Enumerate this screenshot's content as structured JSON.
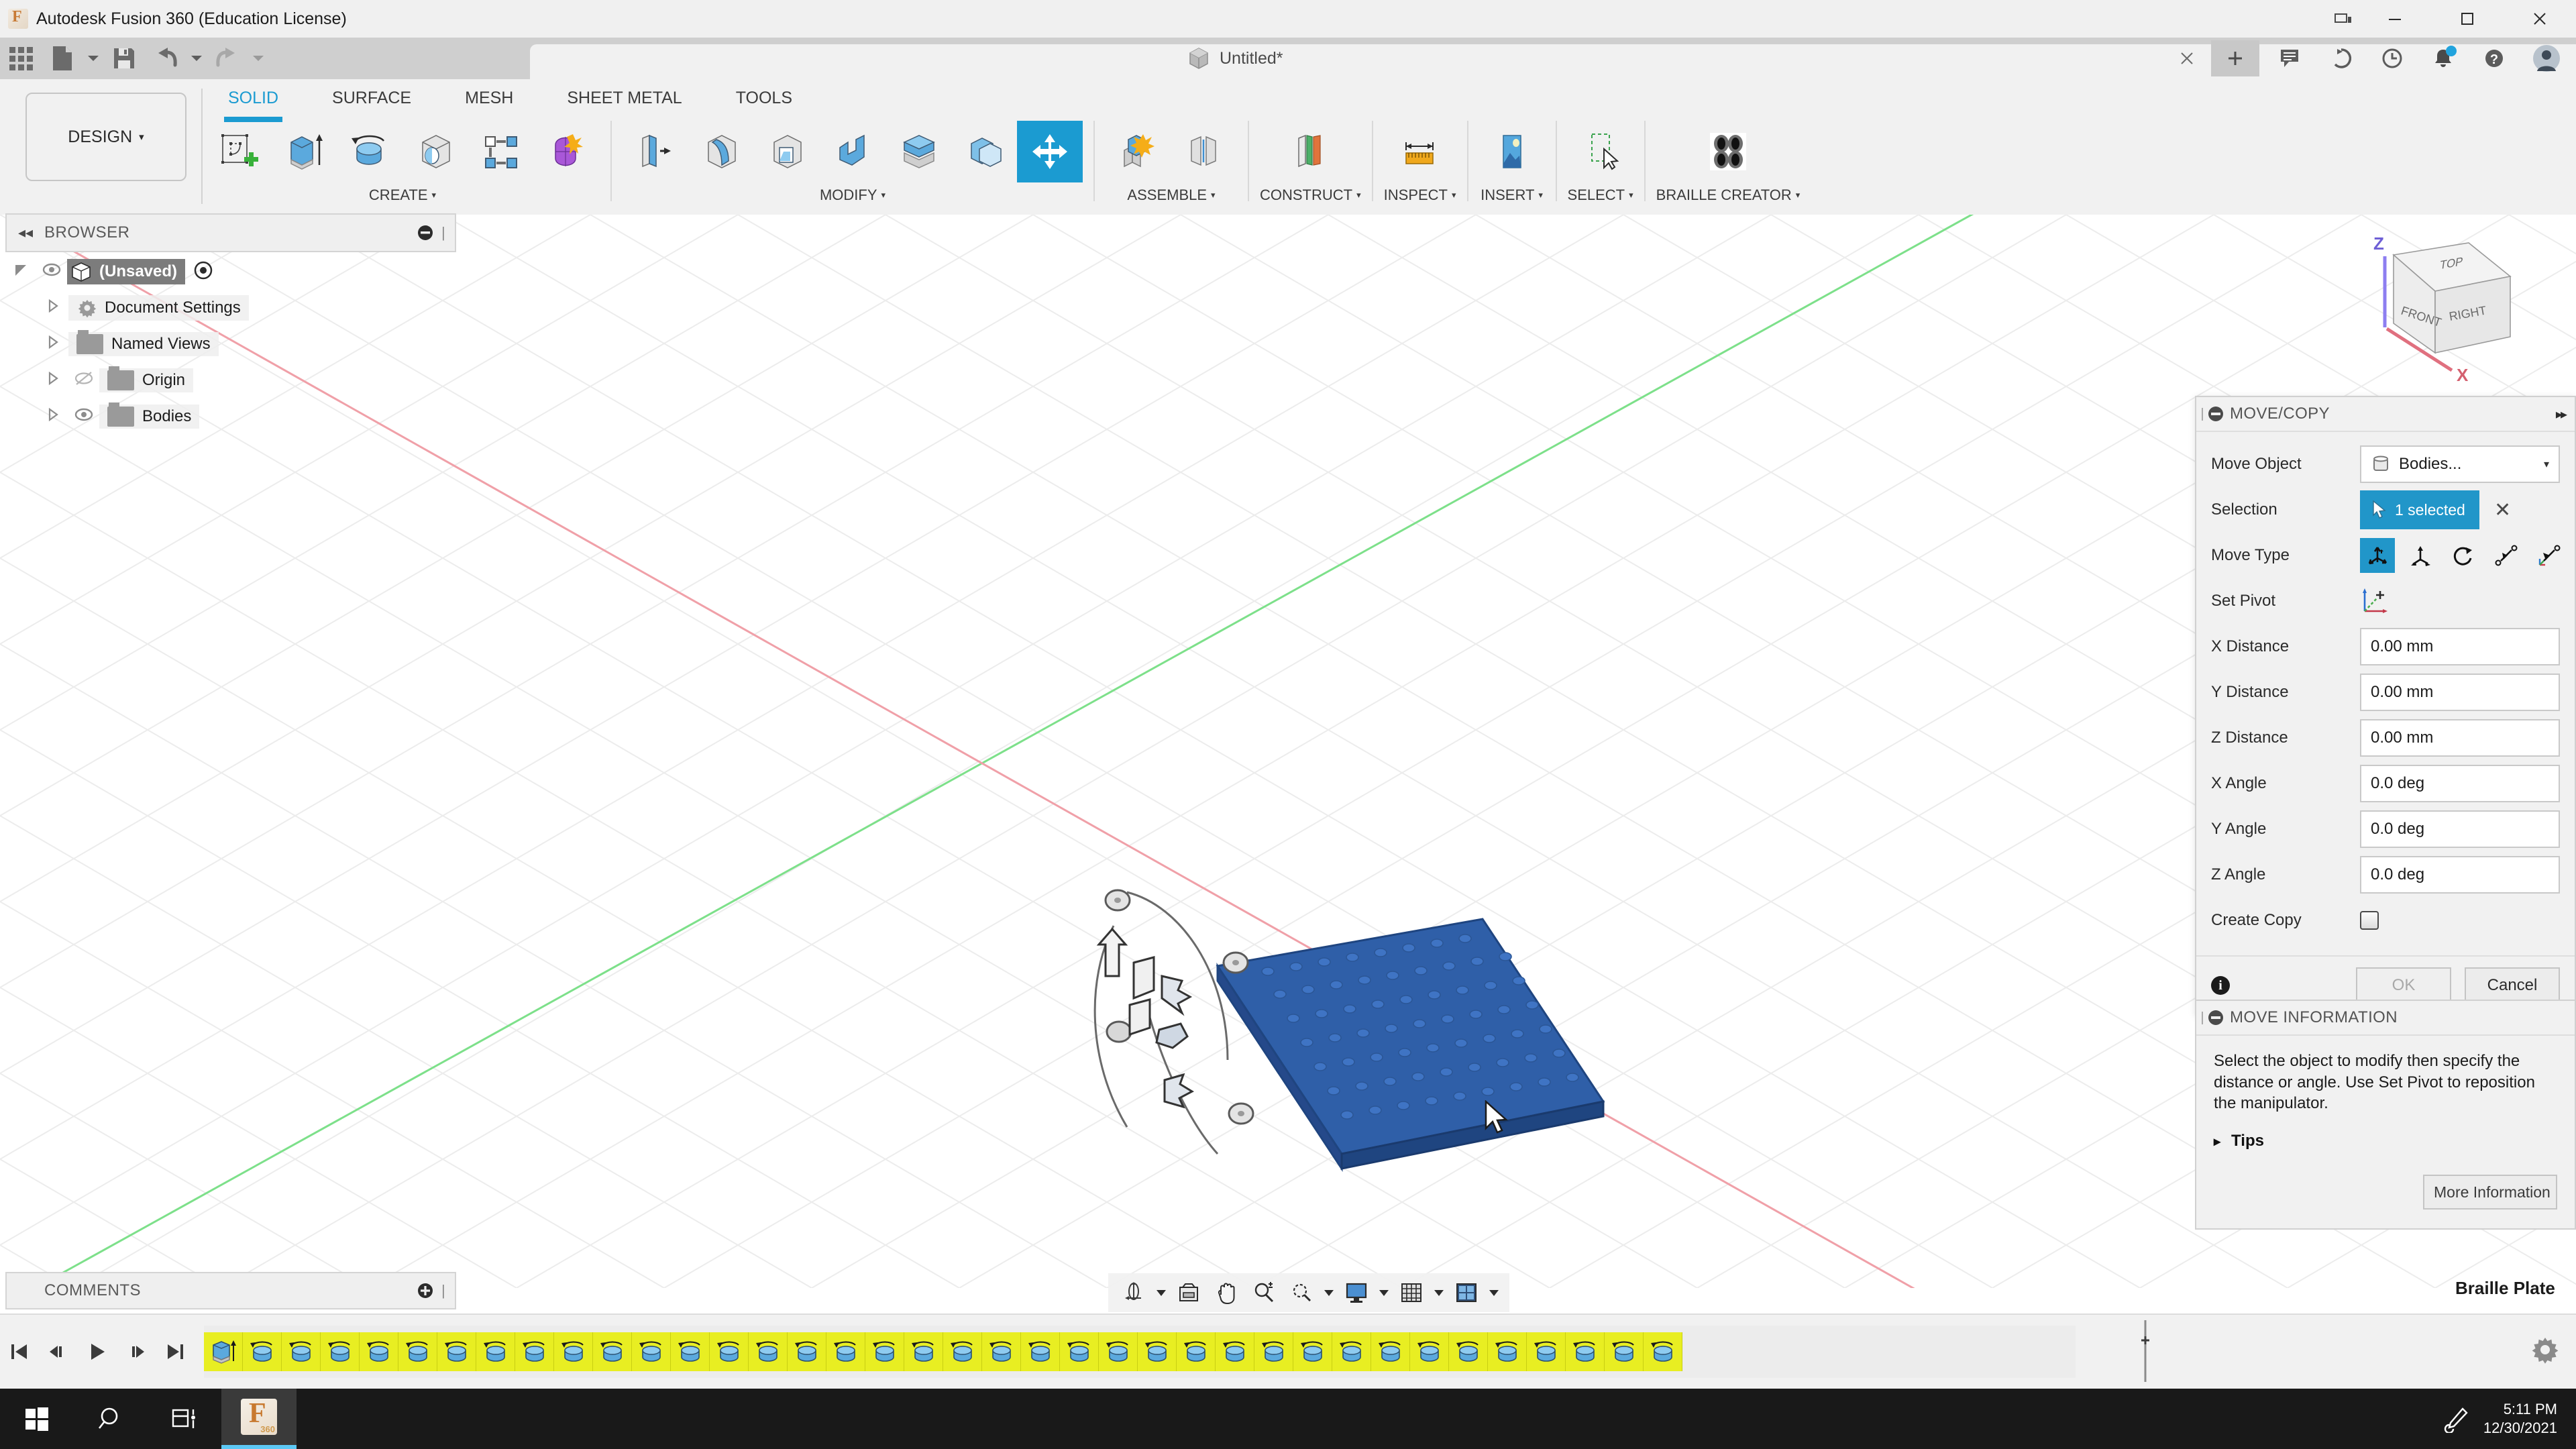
{
  "window": {
    "app_title": "Autodesk Fusion 360 (Education License)",
    "app_icon": "fusion-logo-icon",
    "minimize": "–",
    "maximize": "☐",
    "close": "✕"
  },
  "quick_access": {
    "items": [
      {
        "name": "app-grid-button",
        "icon": "grid-icon"
      },
      {
        "name": "new-file-button",
        "icon": "file-icon",
        "has_caret": true
      },
      {
        "name": "save-button",
        "icon": "save-icon"
      },
      {
        "name": "undo-button",
        "icon": "undo-icon",
        "has_caret": true
      },
      {
        "name": "redo-button",
        "icon": "redo-icon",
        "has_caret": true
      }
    ]
  },
  "document_tab": {
    "title": "Untitled*",
    "close_label": "✕",
    "add_label": "+"
  },
  "header_icons": [
    {
      "name": "comments-icon",
      "glyph": "💬"
    },
    {
      "name": "share-icon",
      "glyph": "⟳"
    },
    {
      "name": "history-icon",
      "glyph": "🕐"
    },
    {
      "name": "notifications-icon",
      "glyph": "🔔"
    },
    {
      "name": "help-icon",
      "glyph": "?"
    },
    {
      "name": "account-avatar",
      "glyph": "👤"
    }
  ],
  "workspace_button": {
    "label": "DESIGN",
    "caret": "▾"
  },
  "ribbon": {
    "tabs": [
      {
        "label": "SOLID",
        "active": true
      },
      {
        "label": "SURFACE",
        "active": false
      },
      {
        "label": "MESH",
        "active": false
      },
      {
        "label": "SHEET METAL",
        "active": false
      },
      {
        "label": "TOOLS",
        "active": false
      }
    ],
    "panels": [
      {
        "label": "CREATE",
        "caret": "▾",
        "tools": [
          {
            "name": "create-sketch-tool"
          },
          {
            "name": "extrude-tool"
          },
          {
            "name": "revolve-tool"
          },
          {
            "name": "hole-tool"
          },
          {
            "name": "rib-pattern-tool"
          },
          {
            "name": "form-tool"
          }
        ]
      },
      {
        "label": "MODIFY",
        "caret": "▾",
        "tools": [
          {
            "name": "press-pull-tool"
          },
          {
            "name": "fillet-tool"
          },
          {
            "name": "shell-tool"
          },
          {
            "name": "draft-tool"
          },
          {
            "name": "scale-tool"
          },
          {
            "name": "combine-tool"
          },
          {
            "name": "move-copy-tool",
            "selected": true
          }
        ]
      },
      {
        "label": "ASSEMBLE",
        "caret": "▾",
        "tools": [
          {
            "name": "new-component-tool"
          },
          {
            "name": "joint-tool"
          }
        ]
      },
      {
        "label": "CONSTRUCT",
        "caret": "▾",
        "tools": [
          {
            "name": "offset-plane-tool"
          }
        ]
      },
      {
        "label": "INSPECT",
        "caret": "▾",
        "tools": [
          {
            "name": "measure-tool"
          }
        ]
      },
      {
        "label": "INSERT",
        "caret": "▾",
        "tools": [
          {
            "name": "insert-image-tool"
          }
        ]
      },
      {
        "label": "SELECT",
        "caret": "▾",
        "tools": [
          {
            "name": "select-tool"
          }
        ]
      },
      {
        "label": "BRAILLE CREATOR",
        "caret": "▾",
        "tools": [
          {
            "name": "braille-creator-tool"
          }
        ]
      }
    ]
  },
  "browser": {
    "title": "BROWSER",
    "collapse_glyph": "◂◂",
    "minimize_glyph": "⊖",
    "tree": [
      {
        "label": "(Unsaved)",
        "level": 0,
        "expanded": true,
        "has_eye": true,
        "selected": true,
        "icon": "body-cube-icon"
      },
      {
        "label": "Document Settings",
        "level": 1,
        "expanded": false,
        "has_eye": false,
        "icon": "gear-icon"
      },
      {
        "label": "Named Views",
        "level": 1,
        "expanded": false,
        "has_eye": false,
        "icon": "folder-icon"
      },
      {
        "label": "Origin",
        "level": 1,
        "expanded": false,
        "has_eye": true,
        "eye_off": true,
        "icon": "folder-icon"
      },
      {
        "label": "Bodies",
        "level": 1,
        "expanded": false,
        "has_eye": true,
        "icon": "folder-icon"
      }
    ]
  },
  "viewcube": {
    "top_label": "TOP",
    "front_label": "FRONT",
    "right_label": "RIGHT",
    "axis_z": "Z",
    "axis_x": "X"
  },
  "dialog": {
    "title": "MOVE/COPY",
    "expand_glyph": "▸▸",
    "rows": [
      {
        "label": "Move Object",
        "type": "dropdown",
        "value": "Bodies...",
        "caret": "▾",
        "name": "move-object-dropdown"
      },
      {
        "label": "Selection",
        "type": "selection",
        "value": "1 selected",
        "clear": "✕",
        "name": "selection-field"
      },
      {
        "label": "Move Type",
        "type": "movetype",
        "name": "move-type-group"
      },
      {
        "label": "Set Pivot",
        "type": "pivot",
        "name": "set-pivot-button"
      },
      {
        "label": "X Distance",
        "type": "text",
        "value": "0.00 mm",
        "name": "x-distance-input"
      },
      {
        "label": "Y Distance",
        "type": "text",
        "value": "0.00 mm",
        "name": "y-distance-input"
      },
      {
        "label": "Z Distance",
        "type": "text",
        "value": "0.00 mm",
        "name": "z-distance-input"
      },
      {
        "label": "X Angle",
        "type": "text",
        "value": "0.0 deg",
        "name": "x-angle-input"
      },
      {
        "label": "Y Angle",
        "type": "text",
        "value": "0.0 deg",
        "name": "y-angle-input"
      },
      {
        "label": "Z Angle",
        "type": "text",
        "value": "0.0 deg",
        "name": "z-angle-input"
      },
      {
        "label": "Create Copy",
        "type": "checkbox",
        "checked": false,
        "name": "create-copy-checkbox"
      }
    ],
    "move_types": [
      {
        "name": "free-move-type",
        "selected": true
      },
      {
        "name": "translate-type",
        "selected": false
      },
      {
        "name": "rotate-type",
        "selected": false
      },
      {
        "name": "point-to-point-type",
        "selected": false
      },
      {
        "name": "point-to-position-type",
        "selected": false
      }
    ],
    "ok_label": "OK",
    "ok_disabled": true,
    "cancel_label": "Cancel",
    "info_glyph": "i"
  },
  "move_information": {
    "title": "MOVE INFORMATION",
    "body": "Select the object to modify then specify the distance or angle. Use Set Pivot to reposition the manipulator.",
    "tips_label": "Tips",
    "tips_caret": "▸",
    "more_info_label": "More Information"
  },
  "canvas": {
    "background_label": "Braille Plate",
    "body_color": "#2f5fa8",
    "grid_color": "#efefef",
    "axis_x_color": "#f0a0a8",
    "axis_y_color": "#7de08a"
  },
  "view_toolbar": {
    "items": [
      {
        "name": "orbit-tool",
        "caret": true
      },
      {
        "name": "look-at-tool",
        "caret": false
      },
      {
        "name": "pan-tool",
        "caret": false
      },
      {
        "name": "zoom-tool",
        "caret": false
      },
      {
        "name": "fit-tool",
        "caret": true
      },
      {
        "name": "display-settings-tool",
        "caret": true
      },
      {
        "name": "grid-snaps-tool",
        "caret": true
      },
      {
        "name": "viewports-tool",
        "caret": true
      }
    ]
  },
  "comments": {
    "title": "COMMENTS",
    "add_glyph": "⊕"
  },
  "timeline": {
    "controls": [
      {
        "name": "go-to-beginning-button",
        "glyph": "⏮"
      },
      {
        "name": "step-back-button",
        "glyph": "◀ı"
      },
      {
        "name": "play-button",
        "glyph": "▶"
      },
      {
        "name": "step-forward-button",
        "glyph": "ı▶"
      },
      {
        "name": "go-to-end-button",
        "glyph": "⏭"
      }
    ],
    "feature_count": 38,
    "first_feature": "extrude-feature",
    "repeat_feature": "revolve-feature",
    "settings_glyph": "⚙"
  },
  "taskbar": {
    "start_glyph": "⊞",
    "search_glyph": "⌕",
    "taskview_glyph": "▣",
    "app_label": "fusion-360-taskbar-icon",
    "pen_glyph": "✎",
    "time": "5:11 PM",
    "date": "12/30/2021"
  }
}
